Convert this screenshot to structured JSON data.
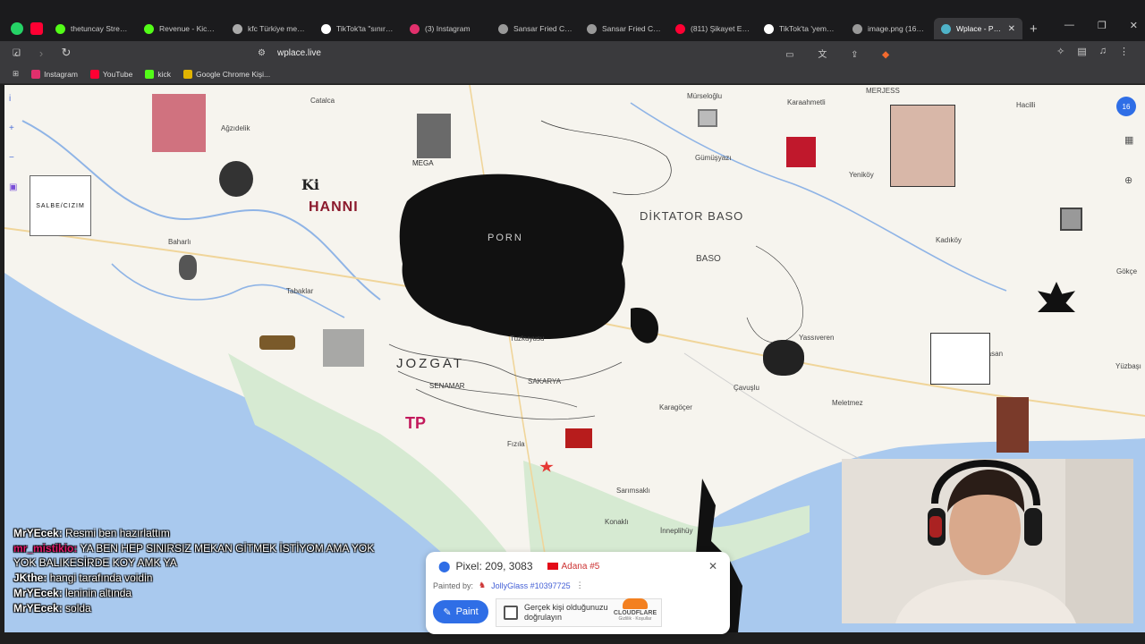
{
  "browser": {
    "tabs": [
      {
        "label": "thetuncay Stream",
        "color": "#53fc18"
      },
      {
        "label": "Revenue - Kick Da",
        "color": "#53fc18"
      },
      {
        "label": "kfc Türkiye menüle",
        "color": "#aaaaaa"
      },
      {
        "label": "TikTok'ta \"sınırsız k",
        "color": "#ffffff"
      },
      {
        "label": "(3) Instagram",
        "color": "#e1306c"
      },
      {
        "label": "Sansar Fried Chick",
        "color": "#999999"
      },
      {
        "label": "Sansar Fried Chick",
        "color": "#999999"
      },
      {
        "label": "(811) Şikayet Etme",
        "color": "#ff0033"
      },
      {
        "label": "TikTok'ta 'yemek' i",
        "color": "#ffffff"
      },
      {
        "label": "image.png (160×1",
        "color": "#999999"
      },
      {
        "label": "Wplace - Paint",
        "color": "#4fb3c9",
        "active": true
      }
    ],
    "new_tab": "+",
    "url": "wplace.live",
    "bookmarks": [
      {
        "label": "Instagram",
        "color": "#e1306c"
      },
      {
        "label": "YouTube",
        "color": "#ff0033"
      },
      {
        "label": "kick",
        "color": "#53fc18"
      },
      {
        "label": "Google Chrome Kişi...",
        "color": "#e0b300"
      }
    ]
  },
  "map": {
    "places": [
      {
        "id": "murseloglu",
        "label": "Mürseloğlu"
      },
      {
        "id": "karaahmetli",
        "label": "Karaahmetli"
      },
      {
        "id": "hacilli",
        "label": "Hacilli"
      },
      {
        "id": "merjess",
        "label": "MERJESS"
      },
      {
        "id": "agzidelik",
        "label": "Ağzıdelik"
      },
      {
        "id": "catalca",
        "label": "Catalca"
      },
      {
        "id": "gumusyazi",
        "label": "Gümüşyazı"
      },
      {
        "id": "yenikoy",
        "label": "Yeniköy"
      },
      {
        "id": "baharli",
        "label": "Baharlı"
      },
      {
        "id": "tabaklar",
        "label": "Tabaklar"
      },
      {
        "id": "kadikoy",
        "label": "Kadıköy"
      },
      {
        "id": "yassiveren",
        "label": "Yassıveren"
      },
      {
        "id": "cavuslu",
        "label": "Çavuşlu"
      },
      {
        "id": "karagocer",
        "label": "Karagöçer"
      },
      {
        "id": "meletmez",
        "label": "Meletmez"
      },
      {
        "id": "kocahasan",
        "label": "Kocahasan"
      },
      {
        "id": "yuzbasi",
        "label": "Yüzbaşı"
      },
      {
        "id": "goksu",
        "label": "Gökçe"
      },
      {
        "id": "sarimsakli",
        "label": "Sarımsaklı"
      },
      {
        "id": "konakli",
        "label": "Konaklı"
      },
      {
        "id": "innepli",
        "label": "İnneplihüy"
      },
      {
        "id": "fizila",
        "label": "Fızıla"
      },
      {
        "id": "tuzkuyusu",
        "label": "Tuzkuyusu"
      },
      {
        "id": "sakarya",
        "label": "SAKARYA"
      }
    ],
    "art_text": {
      "hanni": "HANNI",
      "ki": "Ki",
      "porn": "PORN",
      "jozgat": "JOZGAT",
      "dictator": "DİKTATOR BASO",
      "baso": "BASO",
      "salbe": "SALBE/CIZIM",
      "tp": "TP",
      "mega": "MEGA",
      "senamar": "SENAMAR"
    },
    "zoom_badge": "16"
  },
  "chat": [
    {
      "user": "MrYEcek:",
      "text": "Resmi ben hazırlattım",
      "user_color": "#ffffff"
    },
    {
      "user": "mr_mistikio:",
      "text": "YA BEN HEP SINIRSIZ MEKAN GİTMEK İSTİYOM AMA YOK YOK BALIKESİRDE KOY AMK YA",
      "user_color": "#e01b6a"
    },
    {
      "user": "JKthe:",
      "text": "hangi tarafında voidin",
      "user_color": "#ffffff"
    },
    {
      "user": "MrYEcek:",
      "text": "leninin altında",
      "user_color": "#ffffff"
    },
    {
      "user": "MrYEcek:",
      "text": "solda",
      "user_color": "#ffffff"
    }
  ],
  "pixel_panel": {
    "pixel_label": "Pixel: 209, 3083",
    "region": "Adana #5",
    "painted_by_label": "Painted by:",
    "painter": "JollyGlass #10397725",
    "paint_button": "Paint",
    "captcha_text": "Gerçek kişi olduğunuzu doğrulayın",
    "cloudflare_brand": "CLOUDFLARE",
    "cloudflare_links": "Gizlilik · Koşullar"
  }
}
